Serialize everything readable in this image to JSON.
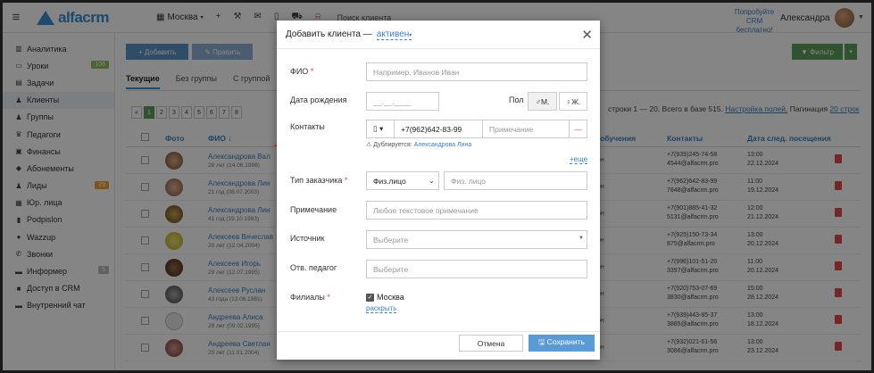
{
  "topbar": {
    "logo": "alfacrm",
    "city": "Москва",
    "search": "Поиск клиента",
    "promo_line1": "Попробуйте",
    "promo_line2": "CRM бесплатно!",
    "user": "Александра",
    "icons": [
      "menu-icon",
      "add-icon",
      "wrench-icon",
      "mail-icon",
      "phone-icon",
      "cart-icon",
      "bell-icon"
    ]
  },
  "sidebar": {
    "items": [
      {
        "label": "Аналитика",
        "icon": "chart-icon"
      },
      {
        "label": "Уроки",
        "icon": "calendar-icon",
        "badge": "106"
      },
      {
        "label": "Задачи",
        "icon": "tasks-icon"
      },
      {
        "label": "Клиенты",
        "icon": "user-icon"
      },
      {
        "label": "Группы",
        "icon": "group-icon"
      },
      {
        "label": "Педагоги",
        "icon": "teacher-icon"
      },
      {
        "label": "Финансы",
        "icon": "money-icon"
      },
      {
        "label": "Абонементы",
        "icon": "ticket-icon"
      },
      {
        "label": "Лиды",
        "icon": "leads-icon",
        "badge": "29"
      },
      {
        "label": "Юр. лица",
        "icon": "building-icon"
      },
      {
        "label": "Podpislon",
        "icon": "doc-icon"
      },
      {
        "label": "Wazzup",
        "icon": "chat-icon"
      },
      {
        "label": "Звонки",
        "icon": "call-icon"
      },
      {
        "label": "Информер",
        "icon": "informer-icon",
        "badge": "5"
      },
      {
        "label": "Доступ в CRM",
        "icon": "lock-icon"
      },
      {
        "label": "Внутренний чат",
        "icon": "message-icon"
      }
    ]
  },
  "main": {
    "add_label": "+ Добавить",
    "edit_label": "✎ Править",
    "filter_label": "▼ Фильтр",
    "tabs": [
      "Текущие",
      "Без группы",
      "С группой"
    ],
    "pages": [
      "«",
      "1",
      "2",
      "3",
      "4",
      "5",
      "6",
      "7",
      "8"
    ],
    "pager_info": "строки 1 — 20. Всего в базе 515.",
    "pager_settings": "Настройка полей.",
    "pager_pagination": "Пагинация",
    "pager_per_page": "20 строк",
    "columns": {
      "photo": "Фото",
      "name": "ФИО ↓",
      "status": "с обучения",
      "contacts": "Контакты",
      "next_visit": "Дата след. посещения"
    },
    "rows": [
      {
        "name": "Александрова Вал",
        "age": "28 лет (14.06.1996)",
        "status": "он",
        "phone": "+7(939)245-74-58",
        "email": "4544@alfacrm.pro",
        "time": "13:00",
        "date": "22.12.2024"
      },
      {
        "name": "Александрова Лин",
        "age": "21 год (08.07.2003)",
        "status": "он",
        "phone": "+7(962)642-83-99",
        "email": "7848@alfacrm.pro",
        "time": "11:00",
        "date": "19.12.2024"
      },
      {
        "name": "Александрова Лин",
        "age": "41 год (19.10.1983)",
        "status": "он",
        "phone": "+7(901)885-41-32",
        "email": "5131@alfacrm.pro",
        "time": "12:00",
        "date": "21.12.2024"
      },
      {
        "name": "Алексеев Вячеслав",
        "age": "20 лет (12.04.2004)",
        "status": "он",
        "phone": "+7(925)150-73-34",
        "email": "875@alfacrm.pro",
        "time": "13:00",
        "date": "20.12.2024"
      },
      {
        "name": "Алексеев Игорь",
        "age": "29 лет (12.07.1995)",
        "status": "он",
        "phone": "+7(996)101-51-20",
        "email": "3397@alfacrm.pro",
        "time": "11:00",
        "date": "20.12.2024"
      },
      {
        "name": "Алексеев Руслан",
        "age": "43 года (13.06.1981)",
        "status": "он",
        "phone": "+7(920)753-07-69",
        "email": "3830@alfacrm.pro",
        "time": "15:00",
        "date": "28.12.2024"
      },
      {
        "name": "Андреева Алиса",
        "age": "29 лет (09.02.1995)",
        "status": "он",
        "phone": "+7(939)443-85-37",
        "email": "3885@alfacrm.pro",
        "time": "13:00",
        "date": "18.12.2024"
      },
      {
        "name": "Андреева Светлан",
        "age": "20 лет (11.01.2004)",
        "status": "он",
        "phone": "+7(932)021-61-56",
        "email": "3086@alfacrm.pro",
        "time": "13:00",
        "date": "23.12.2024"
      }
    ]
  },
  "modal": {
    "title": "Добавить клиента —",
    "status": "активен",
    "fio_label": "ФИО",
    "fio_placeholder": "Например, Иванов Иван",
    "dob_label": "Дата рождения",
    "dob_placeholder": "__.__.____",
    "gender_label": "Пол",
    "gender_m": "М.",
    "gender_f": "Ж.",
    "contacts_label": "Контакты",
    "phone_value": "+7(962)642-83-99",
    "note_placeholder_contact": "Примечание",
    "duplicate_text": "⚠ Дублируется:",
    "duplicate_name": "Александрова Лина",
    "more_link": "+еще",
    "customer_type_label": "Тип заказчика",
    "customer_type_value": "Физ.лицо",
    "customer_type_placeholder": "Физ. лицо",
    "note_label": "Примечание",
    "note_placeholder": "Любое текстовое примечание",
    "source_label": "Источник",
    "source_placeholder": "Выберите",
    "teacher_label": "Отв. педагог",
    "teacher_placeholder": "Выберите",
    "branches_label": "Филиалы",
    "branch_value": "Москва",
    "expand_link": "раскрыть",
    "cancel_label": "Отмена",
    "save_label": "🖫 Сохранить"
  },
  "colors": {
    "accent": "#3b8fd4",
    "annotation_arrow": "#e5332a",
    "green": "#5aa05a"
  }
}
